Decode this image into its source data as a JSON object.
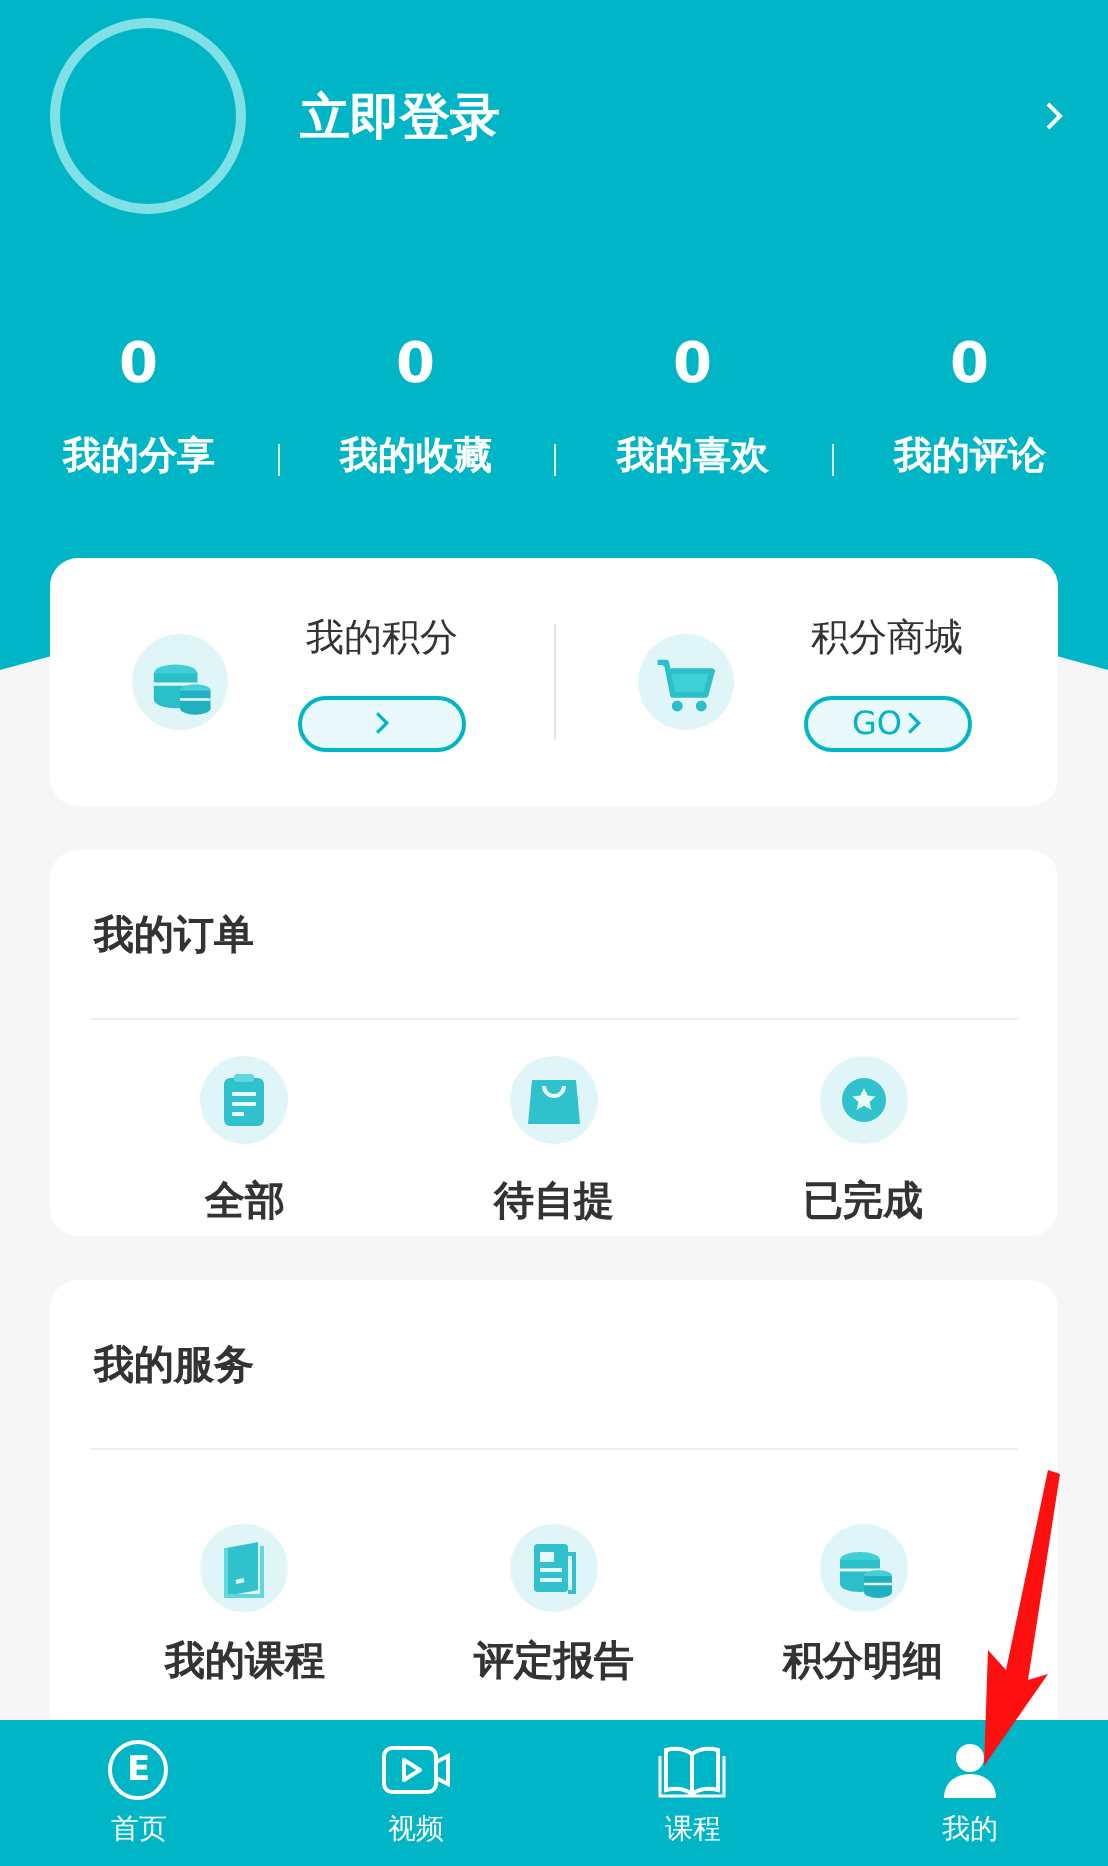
{
  "profile": {
    "login_label": "立即登录"
  },
  "stats": [
    {
      "count": "0",
      "label": "我的分享"
    },
    {
      "count": "0",
      "label": "我的收藏"
    },
    {
      "count": "0",
      "label": "我的喜欢"
    },
    {
      "count": "0",
      "label": "我的评论"
    }
  ],
  "points": [
    {
      "title": "我的积分",
      "kind": "coins"
    },
    {
      "title": "积分商城",
      "kind": "cart",
      "button_label": "GO"
    }
  ],
  "orders": {
    "title": "我的订单",
    "items": [
      {
        "label": "全部",
        "kind": "clipboard"
      },
      {
        "label": "待自提",
        "kind": "bag"
      },
      {
        "label": "已完成",
        "kind": "star"
      }
    ]
  },
  "services": {
    "title": "我的服务",
    "items": [
      {
        "label": "我的课程",
        "kind": "book"
      },
      {
        "label": "评定报告",
        "kind": "report"
      },
      {
        "label": "积分明细",
        "kind": "coins"
      }
    ]
  },
  "tab_bar": [
    {
      "label": "首页",
      "kind": "home",
      "glyph": "E"
    },
    {
      "label": "视频",
      "kind": "video"
    },
    {
      "label": "课程",
      "kind": "book"
    },
    {
      "label": "我的",
      "kind": "person"
    }
  ]
}
